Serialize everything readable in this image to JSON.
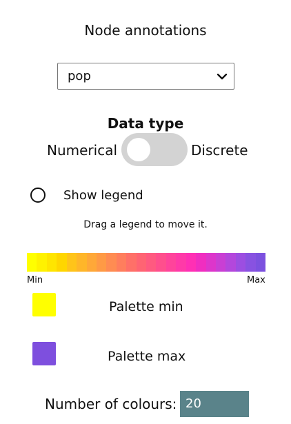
{
  "panel": {
    "title": "Node annotations"
  },
  "annotation_select": {
    "selected_value": "pop"
  },
  "data_type": {
    "label": "Data type",
    "left_option": "Numerical",
    "right_option": "Discrete",
    "state": "Numerical"
  },
  "legend": {
    "show_label": "Show legend",
    "checked": false,
    "drag_hint": "Drag a legend to move it."
  },
  "colour_bar": {
    "min_label": "Min",
    "max_label": "Max",
    "colours": [
      "#ffff00",
      "#fff200",
      "#ffe500",
      "#ffd600",
      "#ffc41a",
      "#ffb629",
      "#ffa838",
      "#ff9a45",
      "#ff8c52",
      "#ff7e5d",
      "#ff7068",
      "#ff6473",
      "#ff5a80",
      "#ff4f8d",
      "#ff449b",
      "#ff3aa8",
      "#ff30b4",
      "#f02ec0",
      "#dd36cb",
      "#c93fd4",
      "#b347dc",
      "#9c4ee1",
      "#8852e1",
      "#7c51df"
    ]
  },
  "palette": {
    "min_label": "Palette min",
    "min_colour": "#ffff00",
    "max_label": "Palette max",
    "max_colour": "#7e4fde"
  },
  "num_colours": {
    "label": "Number of colours:",
    "value": "20"
  }
}
